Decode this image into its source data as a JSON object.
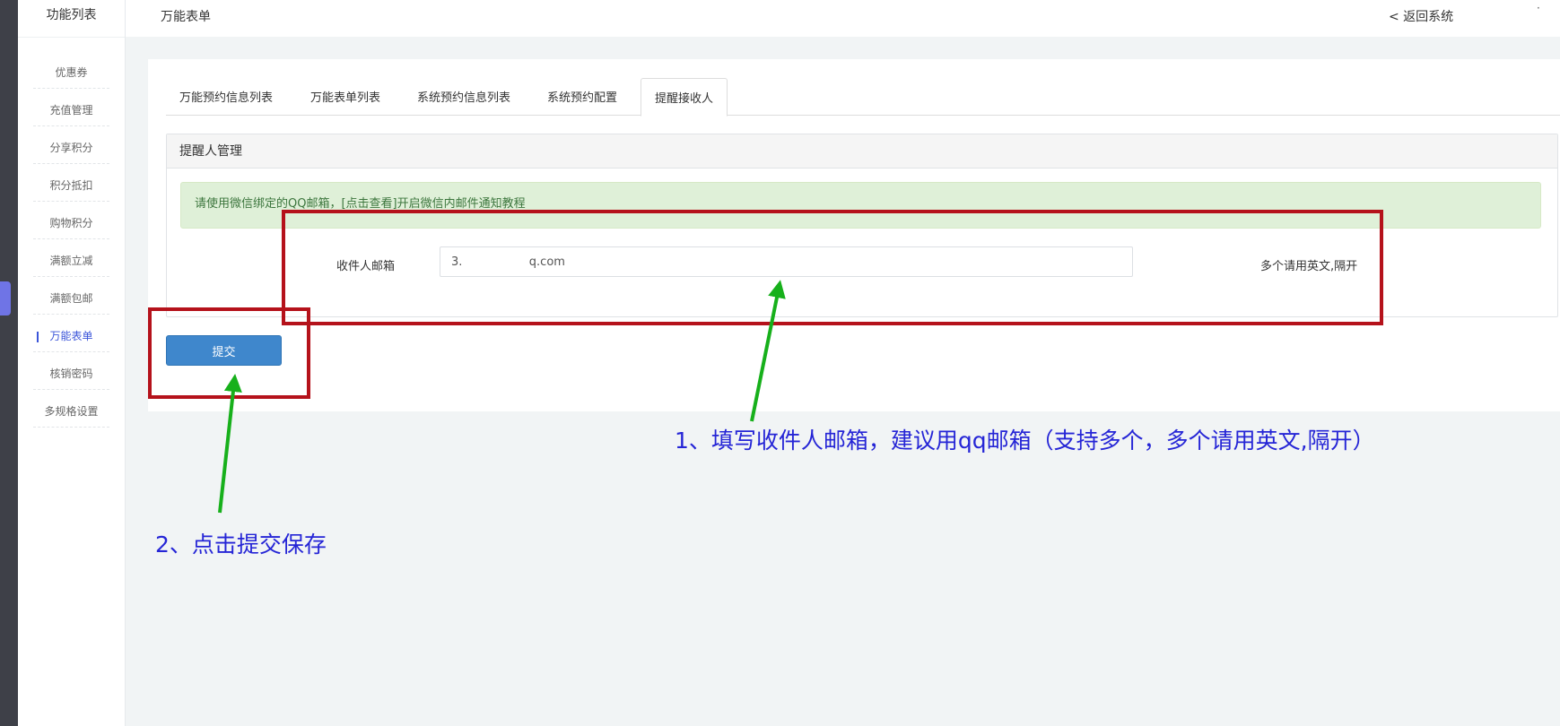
{
  "sidebar": {
    "title": "功能列表",
    "items": [
      {
        "label": "优惠券"
      },
      {
        "label": "充值管理"
      },
      {
        "label": "分享积分"
      },
      {
        "label": "积分抵扣"
      },
      {
        "label": "购物积分"
      },
      {
        "label": "满额立减"
      },
      {
        "label": "满额包邮"
      },
      {
        "label": "万能表单"
      },
      {
        "label": "核销密码"
      },
      {
        "label": "多规格设置"
      }
    ],
    "active_index": 7
  },
  "header": {
    "title": "万能表单",
    "back_label": "< 返回系统",
    "dot": "·"
  },
  "tabs": [
    {
      "label": "万能预约信息列表"
    },
    {
      "label": "万能表单列表"
    },
    {
      "label": "系统预约信息列表"
    },
    {
      "label": "系统预约配置"
    },
    {
      "label": "提醒接收人"
    }
  ],
  "active_tab": 4,
  "section": {
    "title": "提醒人管理",
    "notice": "请使用微信绑定的QQ邮箱，[点击查看]开启微信内邮件通知教程",
    "field_label": "收件人邮箱",
    "email_value": "3.                  q.com",
    "hint": "多个请用英文,隔开"
  },
  "submit_label": "提交",
  "annotations": {
    "step1": "1、填写收件人邮箱，建议用qq邮箱（支持多个，多个请用英文,隔开）",
    "step2": "2、点击提交保存"
  },
  "colors": {
    "highlight_box": "#b5121b",
    "arrow": "#17b01b",
    "annotation_text": "#2525d6",
    "primary_button": "#3f87cc",
    "active_nav": "#3b55d9"
  }
}
